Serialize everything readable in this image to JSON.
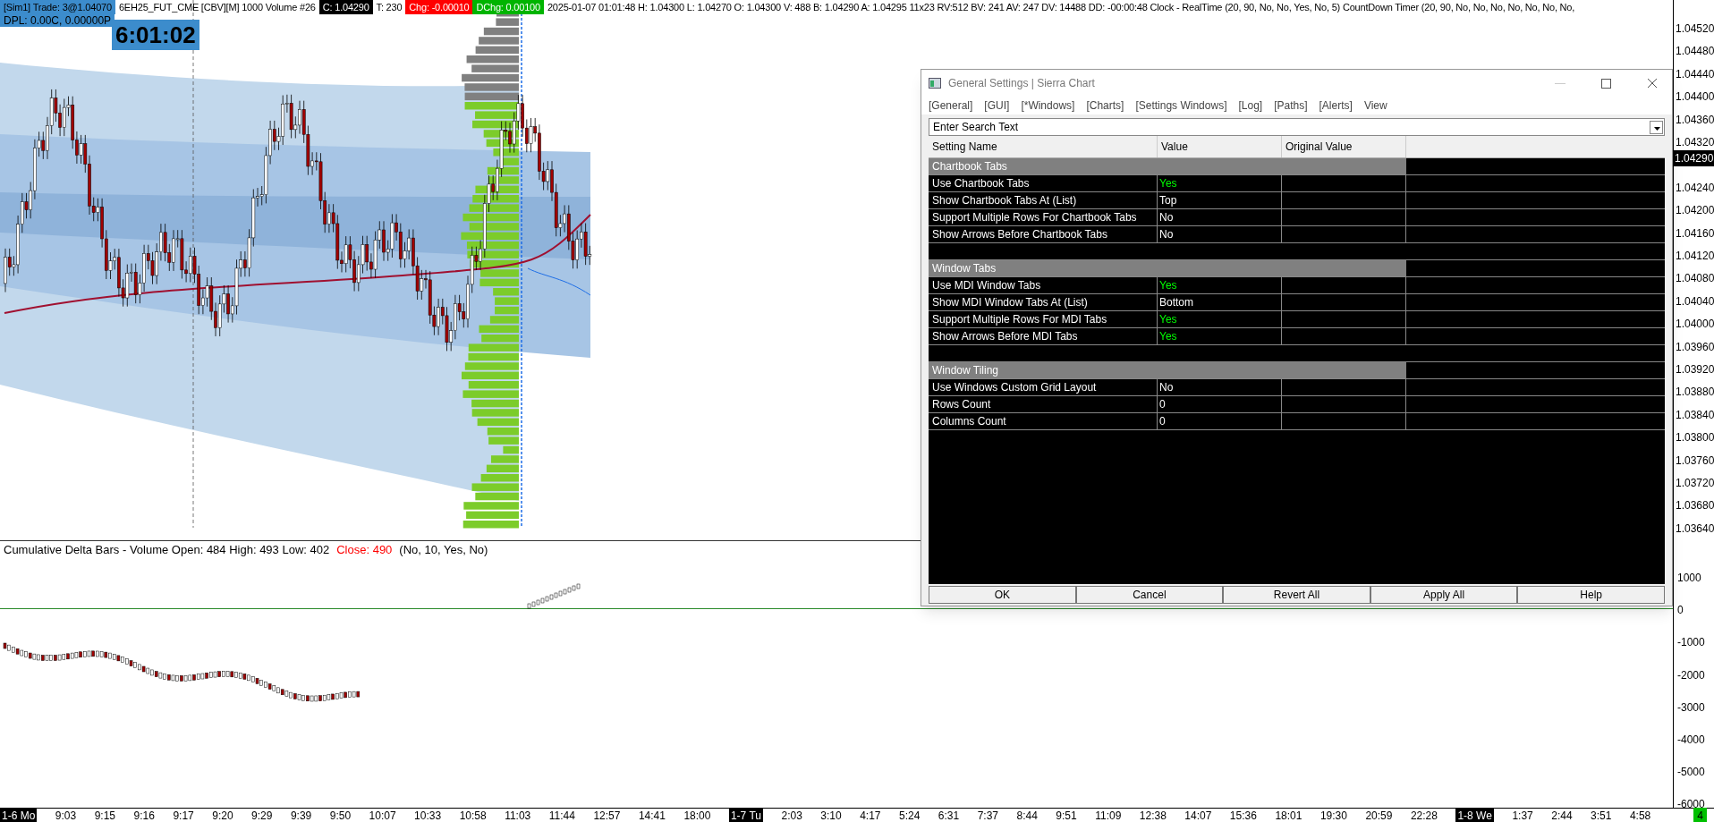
{
  "header": {
    "segments": [
      {
        "text": "[Sim1]  Trade: 3@1.04070",
        "kind": "blue"
      },
      {
        "text": "6EH25_FUT_CME [CBV][M]  1000 Volume #26",
        "kind": "plain"
      },
      {
        "text": "C: 1.04290",
        "kind": "black"
      },
      {
        "text": "T: 230",
        "kind": "plain"
      },
      {
        "text": "Chg: -0.00010",
        "kind": "red"
      },
      {
        "text": "DChg: 0.00100",
        "kind": "green"
      },
      {
        "text": "2025-01-07 01:01:48 H: 1.04300 L: 1.04270 O: 1.04300 V: 488 B: 1.04290 A: 1.04295 11x23 RV:512 BV: 241 AV: 247 DV: 14488 DD: -00:00:48 Clock - RealTime   (20, 90, No, No, Yes, No, 5)  CountDown Timer   (20, 90, No, No, No, No, No, No, No,",
        "kind": "plain"
      }
    ],
    "dpl": "DPL: 0.00C, 0.00000P"
  },
  "clock": "6:01:02",
  "price_axis": {
    "labels": [
      "1.04520",
      "1.04480",
      "1.04440",
      "1.04400",
      "1.04360",
      "1.04320",
      "1.04240",
      "1.04200",
      "1.04160",
      "1.04120",
      "1.04080",
      "1.04040",
      "1.04000",
      "1.03960",
      "1.03920",
      "1.03880",
      "1.03840",
      "1.03800",
      "1.03760",
      "1.03720",
      "1.03680",
      "1.03640"
    ],
    "current": "1.04290"
  },
  "subgraph": {
    "segments": [
      {
        "text": "Cumulative Delta Bars - Volume  Open: 484  High: 493  Low: 402",
        "kind": "plain"
      },
      {
        "text": "Close: 490",
        "kind": "red"
      },
      {
        "text": "(No, 10, Yes, No)",
        "kind": "plain"
      }
    ],
    "axis": [
      "1000",
      "0",
      "-1000",
      "-2000",
      "-3000",
      "-4000",
      "-5000",
      "-6000"
    ]
  },
  "time_axis": [
    {
      "text": "1-6 Mo",
      "kind": "date"
    },
    {
      "text": "9:03",
      "kind": "time"
    },
    {
      "text": "9:15",
      "kind": "time"
    },
    {
      "text": "9:16",
      "kind": "time"
    },
    {
      "text": "9:17",
      "kind": "time"
    },
    {
      "text": "9:20",
      "kind": "time"
    },
    {
      "text": "9:29",
      "kind": "time"
    },
    {
      "text": "9:39",
      "kind": "time"
    },
    {
      "text": "9:50",
      "kind": "time"
    },
    {
      "text": "10:07",
      "kind": "time"
    },
    {
      "text": "10:33",
      "kind": "time"
    },
    {
      "text": "10:58",
      "kind": "time"
    },
    {
      "text": "11:03",
      "kind": "time"
    },
    {
      "text": "11:44",
      "kind": "time"
    },
    {
      "text": "12:57",
      "kind": "time"
    },
    {
      "text": "14:41",
      "kind": "time"
    },
    {
      "text": "18:00",
      "kind": "time"
    },
    {
      "text": "1-7 Tu",
      "kind": "date"
    },
    {
      "text": "2:03",
      "kind": "time"
    },
    {
      "text": "3:10",
      "kind": "time"
    },
    {
      "text": "4:17",
      "kind": "time"
    },
    {
      "text": "5:24",
      "kind": "time"
    },
    {
      "text": "6:31",
      "kind": "time"
    },
    {
      "text": "7:37",
      "kind": "time"
    },
    {
      "text": "8:44",
      "kind": "time"
    },
    {
      "text": "9:51",
      "kind": "time"
    },
    {
      "text": "11:09",
      "kind": "time"
    },
    {
      "text": "12:38",
      "kind": "time"
    },
    {
      "text": "14:07",
      "kind": "time"
    },
    {
      "text": "15:36",
      "kind": "time"
    },
    {
      "text": "18:01",
      "kind": "time"
    },
    {
      "text": "19:30",
      "kind": "time"
    },
    {
      "text": "20:59",
      "kind": "time"
    },
    {
      "text": "22:28",
      "kind": "time"
    },
    {
      "text": "1-8 We",
      "kind": "date"
    },
    {
      "text": "1:37",
      "kind": "time"
    },
    {
      "text": "2:44",
      "kind": "time"
    },
    {
      "text": "3:51",
      "kind": "time"
    },
    {
      "text": "4:58",
      "kind": "time"
    }
  ],
  "corner_badge": "4",
  "dialog": {
    "title": "General Settings | Sierra Chart",
    "menu": [
      "[General]",
      "[GUI]",
      "[*Windows]",
      "[Charts]",
      "[Settings Windows]",
      "[Log]",
      "[Paths]",
      "[Alerts]",
      "View"
    ],
    "search": {
      "placeholder": "Enter Search Text"
    },
    "columns": [
      "Setting Name",
      "Value",
      "Original Value"
    ],
    "rows": [
      {
        "kind": "section",
        "name": "Chartbook Tabs"
      },
      {
        "kind": "setting",
        "name": "Use Chartbook Tabs",
        "value": "Yes",
        "color": "#00ff00"
      },
      {
        "kind": "setting",
        "name": "Show Chartbook Tabs At (List)",
        "value": "Top",
        "color": "#ffffff"
      },
      {
        "kind": "setting",
        "name": "Support Multiple Rows For Chartbook Tabs",
        "value": "No",
        "color": "#ffffff"
      },
      {
        "kind": "setting",
        "name": "Show Arrows Before Chartbook Tabs",
        "value": "No",
        "color": "#ffffff"
      },
      {
        "kind": "spacer"
      },
      {
        "kind": "section",
        "name": "Window Tabs"
      },
      {
        "kind": "setting",
        "name": "Use MDI Window Tabs",
        "value": "Yes",
        "color": "#00ff00"
      },
      {
        "kind": "setting",
        "name": "Show MDI Window Tabs At (List)",
        "value": "Bottom",
        "color": "#ffffff"
      },
      {
        "kind": "setting",
        "name": "Support Multiple Rows For MDI Tabs",
        "value": "Yes",
        "color": "#00ff00"
      },
      {
        "kind": "setting",
        "name": "Show Arrows Before MDI Tabs",
        "value": "Yes",
        "color": "#00ff00"
      },
      {
        "kind": "spacer"
      },
      {
        "kind": "section",
        "name": "Window Tiling"
      },
      {
        "kind": "setting",
        "name": "Use Windows Custom Grid Layout",
        "value": "No",
        "color": "#ffffff"
      },
      {
        "kind": "setting",
        "name": "Rows Count",
        "value": "0",
        "color": "#ffffff"
      },
      {
        "kind": "setting",
        "name": "Columns Count",
        "value": "0",
        "color": "#ffffff"
      }
    ],
    "buttons": [
      "OK",
      "Cancel",
      "Revert All",
      "Apply All",
      "Help"
    ]
  }
}
